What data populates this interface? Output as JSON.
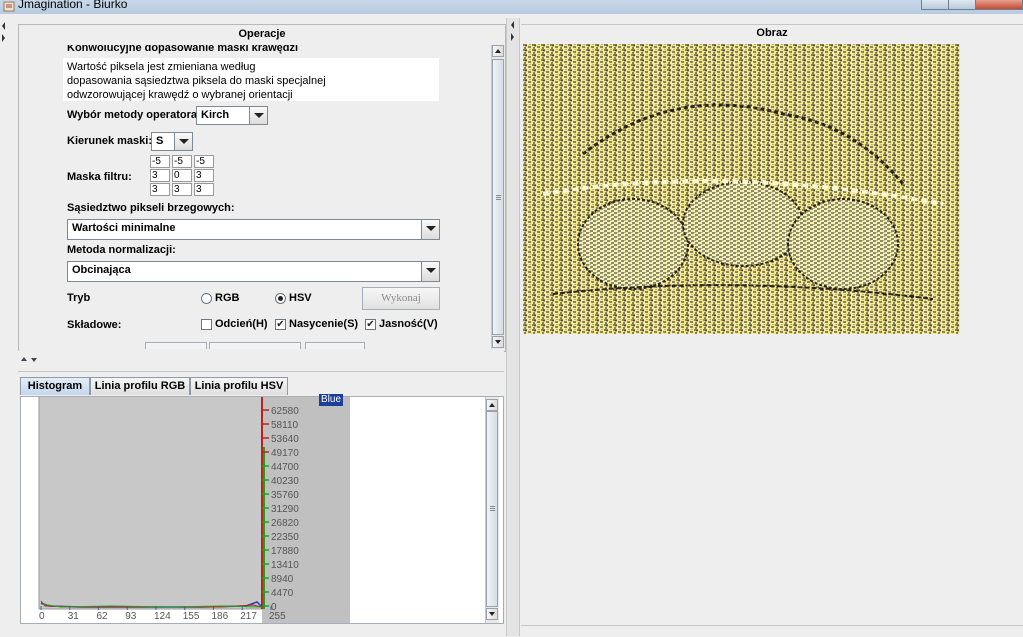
{
  "window": {
    "title": "Jmagination - Biurko"
  },
  "operacje": {
    "header": "Operacje",
    "section_title": "Konwolucyjne dopasowanie maski krawędzi",
    "description_lines": [
      "Wartość piksela jest zmieniana według",
      "dopasowania sąsiedztwa piksela do maski specjalnej",
      "odwzorowującej krawędź o wybranej orientacji"
    ],
    "operator_label": "Wybór metody operatora:",
    "operator_value": "Kirch",
    "direction_label": "Kierunek maski:",
    "direction_value": "S",
    "mask_label": "Maska filtru:",
    "mask": [
      [
        "-5",
        "-5",
        "-5"
      ],
      [
        "3",
        "0",
        "3"
      ],
      [
        "3",
        "3",
        "3"
      ]
    ],
    "neighbourhood_label": "Sąsiedztwo pikseli brzegowych:",
    "neighbourhood_value": "Wartości minimalne",
    "normalization_label": "Metoda normalizacji:",
    "normalization_value": "Obcinająca",
    "mode_label": "Tryb",
    "mode_rgb": "RGB",
    "mode_hsv": "HSV",
    "mode_selected": "HSV",
    "execute_button": "Wykonaj",
    "components_label": "Składowe:",
    "components": [
      {
        "label": "Odcień(H)",
        "checked": false
      },
      {
        "label": "Nasycenie(S)",
        "checked": true
      },
      {
        "label": "Jasność(V)",
        "checked": true
      }
    ]
  },
  "tabs": [
    "Histogram",
    "Linia profilu RGB",
    "Linia profilu HSV"
  ],
  "active_tab": "Histogram",
  "histogram": {
    "legend": "Blue",
    "y_ticks": [
      "62580",
      "58110",
      "53640",
      "49170",
      "44700",
      "40230",
      "35760",
      "31290",
      "26820",
      "22350",
      "17880",
      "13410",
      "8940",
      "4470",
      "0"
    ],
    "x_ticks": [
      "0",
      "31",
      "62",
      "93",
      "124",
      "155",
      "186",
      "217",
      "255"
    ]
  },
  "obraz": {
    "header": "Obraz"
  },
  "colors": {
    "accent": "#1c3f9c",
    "tab_active": "#c3d6ea",
    "image_bg": "#f2ea8a"
  }
}
